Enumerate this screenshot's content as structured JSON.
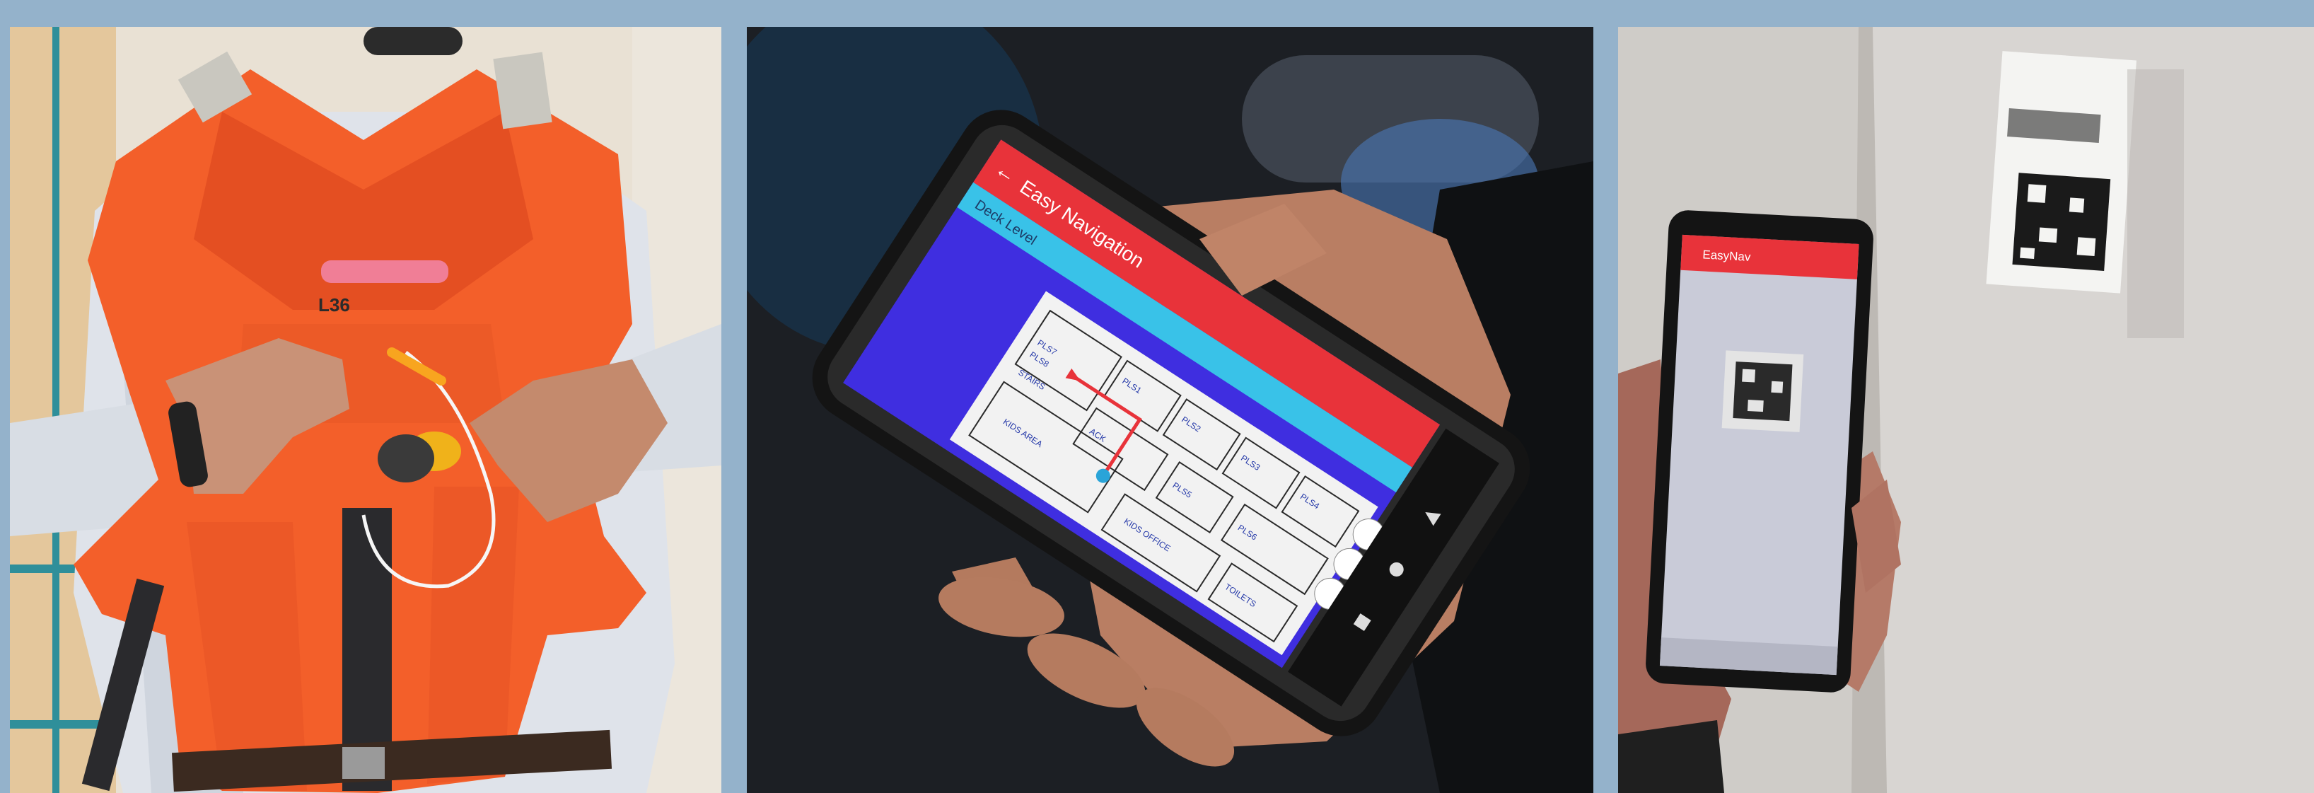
{
  "photos": [
    {
      "id": "life-vest"
    },
    {
      "id": "phone-navigation"
    },
    {
      "id": "phone-qr-scan"
    }
  ],
  "vest": {
    "tag": "L36"
  },
  "nav_app": {
    "app_title": "Easy Navigation",
    "level_label": "Deck Level",
    "room_labels": [
      "PLS1",
      "PLS2",
      "PLS3",
      "PLS4",
      "ACK",
      "PLS5",
      "PLS6",
      "PLS7",
      "PLS8",
      "KIDS AREA",
      "KIDS OFFICE",
      "TOILETS",
      "STAIRS"
    ]
  },
  "scan_app": {
    "title": "EasyNav"
  },
  "colors": {
    "accent_red": "#e8333a",
    "map_bg": "#3f2ee0",
    "header_cyan": "#39c2e8",
    "vest_orange": "#f35f2a"
  }
}
